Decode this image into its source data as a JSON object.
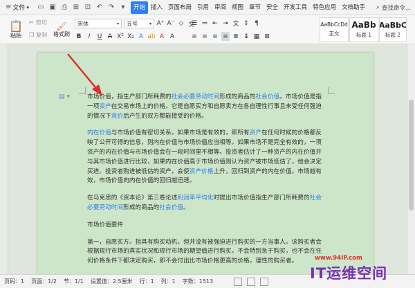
{
  "tabbar": {
    "file": "文件",
    "tabs": [
      "开始",
      "插入",
      "页面布局",
      "引用",
      "审阅",
      "视图",
      "章节",
      "安全",
      "开发工具",
      "特色应用",
      "文档助手"
    ],
    "active_tab": "开始",
    "search": "查找命令..."
  },
  "toolbar": {
    "paste": "粘贴",
    "cut": "剪切",
    "copy": "复制",
    "format_painter": "格式刷",
    "font_name": "宋体",
    "font_size": "五号",
    "styles": [
      {
        "sample": "AaBbCcDd",
        "label": "正文"
      },
      {
        "sample": "AaBb",
        "label": "标题 1"
      },
      {
        "sample": "AaBbC",
        "label": "标题 2"
      }
    ]
  },
  "document": {
    "p1": [
      {
        "t": "市场价值，指生产部门所耗费的"
      },
      {
        "t": "社会必要劳动时间",
        "link": true
      },
      {
        "t": "形成的商品的"
      },
      {
        "t": "社会价值",
        "link": true
      },
      {
        "t": "。市场价值是指一项"
      },
      {
        "t": "资产",
        "link": true
      },
      {
        "t": "在交易市场上的价格，它是自愿买方和自愿卖方在各自理性行事且未受任何强迫的情况下"
      },
      {
        "t": "竞价",
        "link": true
      },
      {
        "t": "后产生的双方都能接受的价格。"
      }
    ],
    "p2": [
      {
        "t": "内在价值",
        "link": true
      },
      {
        "t": "与市场价值有密切关系。如果市场是有效的，即所有"
      },
      {
        "t": "资产",
        "link": true
      },
      {
        "t": "在任何时候的价格都反映了公开可得的信息，则内在价值与市场价值应当相等。如果市场不是完全有效的，一项资产的内在价值与市场价值会在一段时间里不相等。投资者估计了一种资产的内在价值并与其市场价值进行比较，如果内在价值高于市场价值则认为资产被市场低估了，他会决定买进。投资者购进被低估的资产，会使"
      },
      {
        "t": "资产价格",
        "link": true
      },
      {
        "t": "上升，回归到资产的内在价值。市场越有效，市场价值向内在价值的回归越迅速。"
      }
    ],
    "p3": [
      {
        "t": "在马克思的《资本论》第三卷论述"
      },
      {
        "t": "利润率平均化",
        "link": true
      },
      {
        "t": "时提出市场价值指生产部门所耗费的"
      },
      {
        "t": "社会必要劳动时间",
        "link": true
      },
      {
        "t": "形成的商品的"
      },
      {
        "t": "社会价值",
        "link": true
      },
      {
        "t": "。"
      }
    ],
    "heading": "市场价值要件",
    "p4": [
      {
        "t": "第一，自愿买方。指具有购买动机，但并没有被强迫进行购买的一方当事人。该购买者会根据现行市场的真实状况和现行市场的期望值进行购买，不会特别急于购买，也不会在任何价格条件下都决定购买，即不会付出比市场价格更高的价格。理性的购买者。"
      }
    ]
  },
  "status": {
    "page_num": "页码：1",
    "pages": "页面：1/2",
    "section": "节：1/1",
    "setting": "设置值：2.5厘米",
    "row": "行：1",
    "col": "列：1",
    "words": "字数：1513"
  },
  "watermark": {
    "url": "www.94IP.com",
    "brand": "IT运维空间"
  },
  "colors": {
    "accent": "#2f7ff0",
    "link": "#2f7ff0",
    "page_bg": "#cde5c8",
    "arrow": "#e02a2a"
  }
}
